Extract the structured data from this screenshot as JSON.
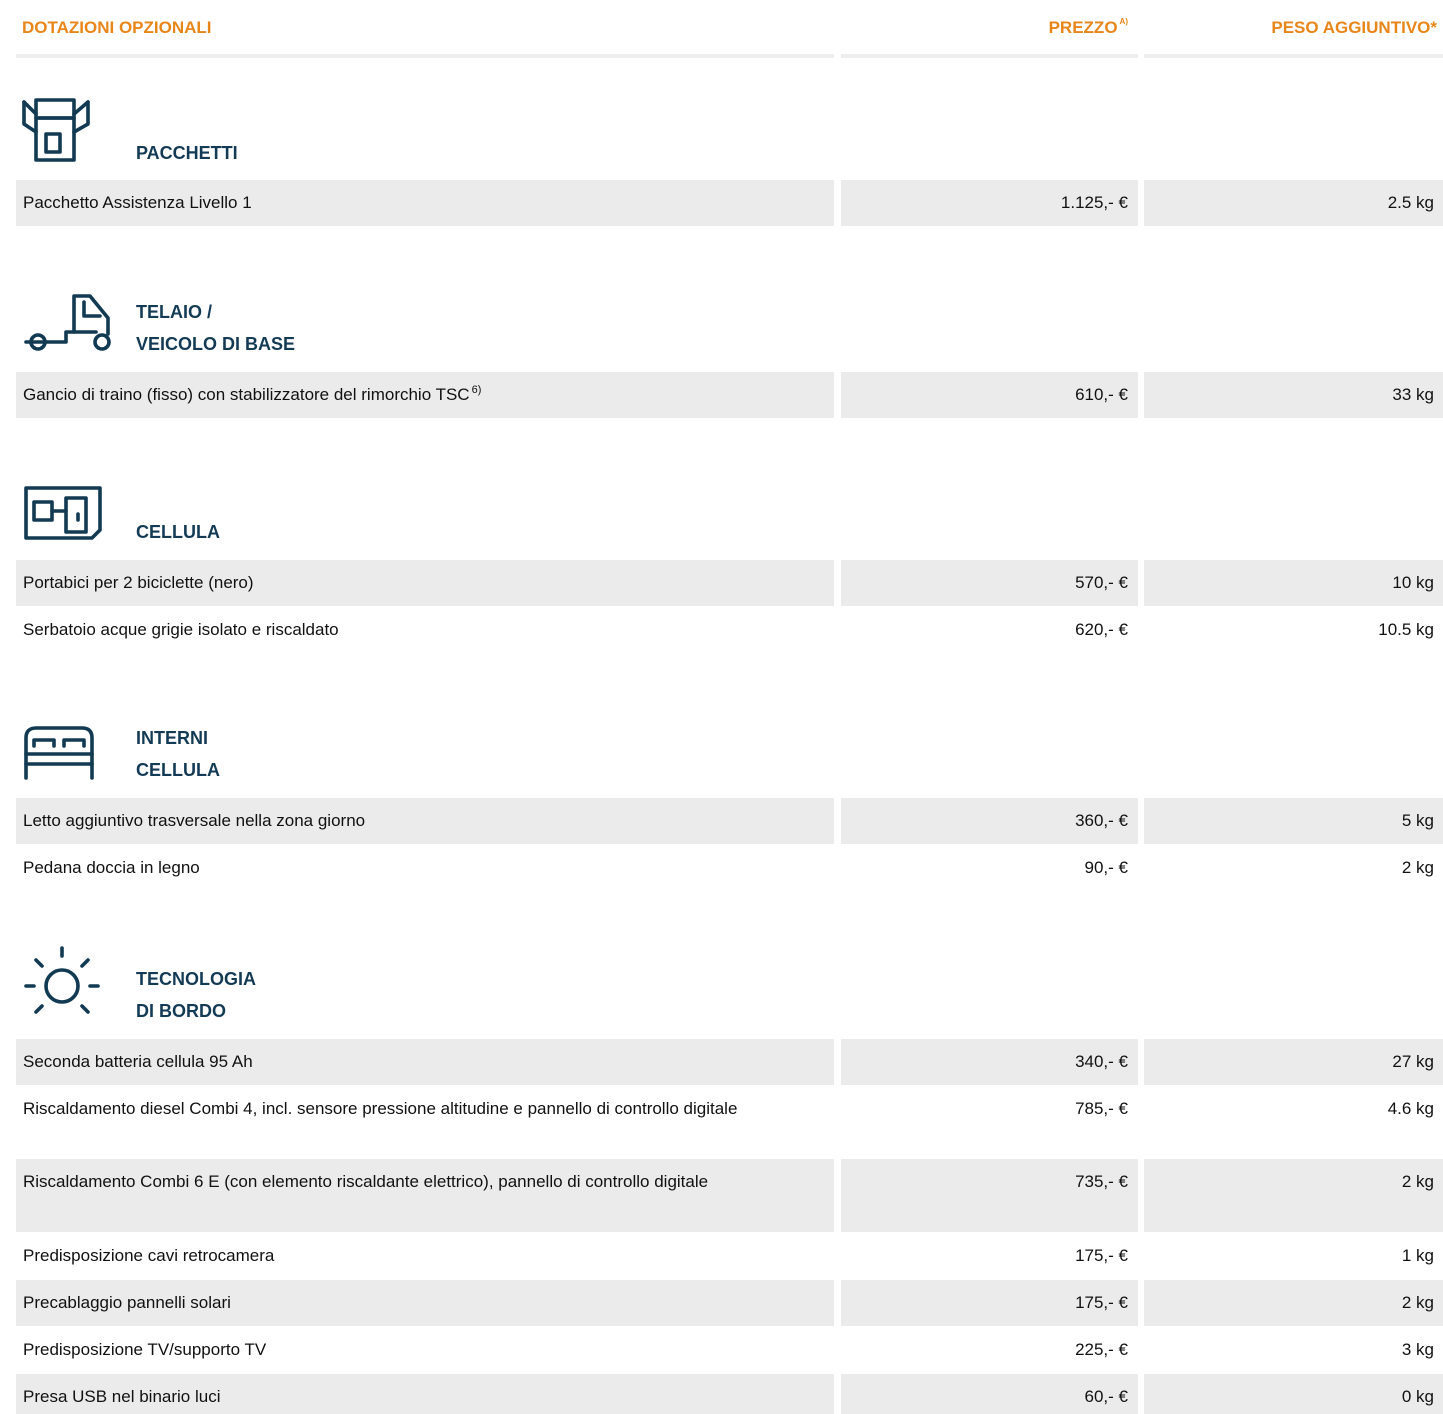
{
  "header": {
    "col1": "DOTAZIONI OPZIONALI",
    "col2": "PREZZO",
    "col2_note": "A)",
    "col3": "PESO AGGIUNTIVO*"
  },
  "colors": {
    "accent": "#e8861a",
    "heading": "#143b55",
    "row_shade": "#ebebeb"
  },
  "sections": [
    {
      "icon": "box-icon",
      "title_lines": [
        "PACCHETTI"
      ],
      "rows": [
        {
          "name": "Pacchetto Assistenza Livello 1",
          "price": "1.125,- €",
          "weight": "2.5 kg"
        }
      ]
    },
    {
      "icon": "truck-chassis-icon",
      "title_lines": [
        "TELAIO /",
        "VEICOLO DI BASE"
      ],
      "rows": [
        {
          "name": "Gancio di traino (fisso) con stabilizzatore del rimorchio TSC",
          "note": "6)",
          "price": "610,- €",
          "weight": "33 kg"
        }
      ]
    },
    {
      "icon": "caravan-body-icon",
      "title_lines": [
        "CELLULA"
      ],
      "rows": [
        {
          "name": "Portabici per 2 biciclette (nero)",
          "price": "570,- €",
          "weight": "10 kg"
        },
        {
          "name": "Serbatoio acque grigie isolato e riscaldato",
          "price": "620,- €",
          "weight": "10.5 kg"
        }
      ]
    },
    {
      "icon": "bed-icon",
      "title_lines": [
        "INTERNI",
        "CELLULA"
      ],
      "rows": [
        {
          "name": "Letto aggiuntivo trasversale nella zona giorno",
          "price": "360,- €",
          "weight": "5 kg"
        },
        {
          "name": "Pedana doccia in legno",
          "price": "90,- €",
          "weight": "2 kg"
        }
      ]
    },
    {
      "icon": "sun-icon",
      "title_lines": [
        "TECNOLOGIA",
        "DI BORDO"
      ],
      "rows": [
        {
          "name": "Seconda batteria cellula 95 Ah",
          "price": "340,- €",
          "weight": "27 kg"
        },
        {
          "name": "Riscaldamento diesel Combi 4, incl. sensore pressione altitudine e pannello di controllo digitale",
          "price": "785,- €",
          "weight": "4.6 kg"
        },
        {
          "name": "Riscaldamento Combi 6 E (con elemento riscaldante elettrico), pannello di controllo digitale",
          "price": "735,- €",
          "weight": "2 kg"
        },
        {
          "name": "Predisposizione cavi retrocamera",
          "price": "175,- €",
          "weight": "1 kg"
        },
        {
          "name": "Precablaggio pannelli solari",
          "price": "175,- €",
          "weight": "2 kg"
        },
        {
          "name": "Predisposizione TV/supporto TV",
          "price": "225,- €",
          "weight": "3 kg"
        },
        {
          "name": "Presa USB nel binario luci",
          "price": "60,- €",
          "weight": "0 kg"
        }
      ]
    }
  ]
}
